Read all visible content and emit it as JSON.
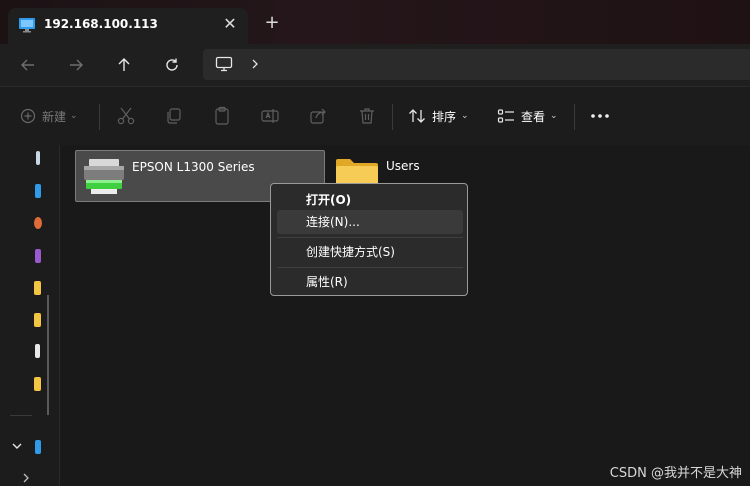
{
  "tab": {
    "title": "192.168.100.113",
    "close_glyph": "✕",
    "new_tab_glyph": "+"
  },
  "toolbar": {
    "new_label": "新建",
    "sort_label": "排序",
    "view_label": "查看"
  },
  "content": {
    "items": [
      {
        "name": "EPSON L1300 Series",
        "icon": "printer-icon"
      },
      {
        "name": "Users",
        "icon": "folder-icon"
      }
    ]
  },
  "context_menu": {
    "items": [
      {
        "label": "打开(O)"
      },
      {
        "label": "连接(N)..."
      },
      {
        "label": "创建快捷方式(S)"
      },
      {
        "label": "属性(R)"
      }
    ]
  },
  "watermark": "CSDN @我并不是大神",
  "colors": {
    "accent_blue": "#4aa3f0",
    "folder_yellow": "#f4c542",
    "printer_green": "#3fcf3f",
    "selection_bg": "#4a4a4a"
  }
}
